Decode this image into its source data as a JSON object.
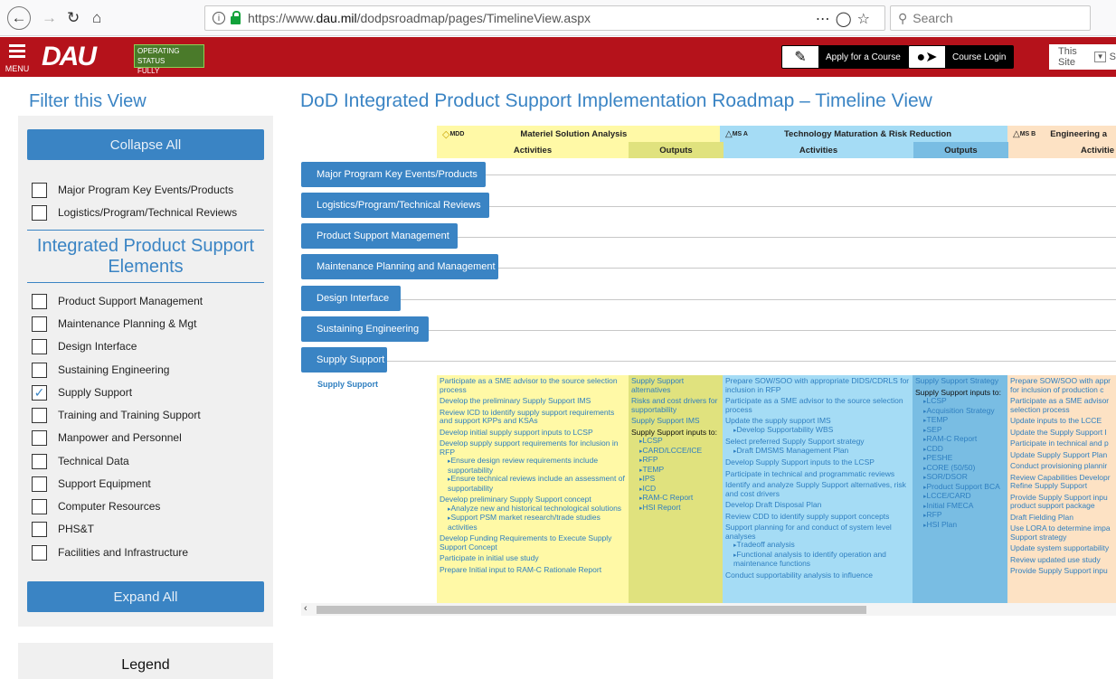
{
  "browser": {
    "url_prefix": "https://www.",
    "url_domain": "dau.mil",
    "url_path": "/dodpsroadmap/pages/TimelineView.aspx",
    "search_placeholder": "Search",
    "icons": [
      "back-arrow",
      "forward-arrow",
      "reload",
      "home",
      "more-dots",
      "pocket",
      "bookmark-star",
      "search-icon"
    ]
  },
  "header": {
    "menu_label": "MENU",
    "logo_text": "DAU",
    "status_line1": "OPERATING STATUS",
    "status_line2": "FULLY OPERATIONAL",
    "apply_label": "Apply for a Course",
    "login_label": "Course Login",
    "scope_label": "This Site",
    "scope_search": "S",
    "accent": "#b5121b"
  },
  "sidebar": {
    "filter_title": "Filter this View",
    "collapse_label": "Collapse All",
    "expand_label": "Expand All",
    "top_filters": [
      {
        "label": "Major Program Key Events/Products",
        "checked": false
      },
      {
        "label": "Logistics/Program/Technical Reviews",
        "checked": false
      }
    ],
    "ips_title": "Integrated Product Support Elements",
    "ips_filters": [
      {
        "label": "Product Support Management",
        "checked": false
      },
      {
        "label": "Maintenance Planning & Mgt",
        "checked": false
      },
      {
        "label": "Design Interface",
        "checked": false
      },
      {
        "label": "Sustaining Engineering",
        "checked": false
      },
      {
        "label": "Supply Support",
        "checked": true
      },
      {
        "label": "Training and Training Support",
        "checked": false
      },
      {
        "label": "Manpower and Personnel",
        "checked": false
      },
      {
        "label": "Technical Data",
        "checked": false
      },
      {
        "label": "Support Equipment",
        "checked": false
      },
      {
        "label": "Computer Resources",
        "checked": false
      },
      {
        "label": "PHS&T",
        "checked": false
      },
      {
        "label": "Facilities and Infrastructure",
        "checked": false
      }
    ],
    "legend_label": "Legend"
  },
  "main": {
    "title": "DoD Integrated Product Support Implementation Roadmap – Timeline View",
    "phases": [
      {
        "milestone": "MDD",
        "name": "Materiel Solution Analysis",
        "activities": "Activities",
        "outputs": "Outputs"
      },
      {
        "milestone": "MS A",
        "name": "Technology Maturation & Risk Reduction",
        "activities": "Activities",
        "outputs": "Outputs"
      },
      {
        "milestone": "MS B",
        "name": "Engineering a",
        "activities": "Activitie"
      }
    ],
    "rows": [
      "Major Program Key Events/Products",
      "Logistics/Program/Technical Reviews",
      "Product Support Management",
      "Maintenance Planning and Management",
      "Design Interface",
      "Sustaining Engineering",
      "Supply Support"
    ],
    "detail_label": "Supply Support",
    "col1": [
      "Participate as a SME advisor to the source selection process",
      "Develop the preliminary Supply Support IMS",
      "Review ICD to identify supply support requirements and support KPPs and KSAs",
      "Develop initial supply support inputs to LCSP",
      "Develop supply support requirements for inclusion in RFP"
    ],
    "col1_sub1": [
      "Ensure design review requirements include supportability",
      "Ensure technical reviews include an assessment of supportability"
    ],
    "col1_b": "Develop preliminary Supply Support concept",
    "col1_sub2": [
      "Analyze new and historical technological solutions",
      "Support PSM market research/trade studies activities"
    ],
    "col1_c": [
      "Develop Funding Requirements to Execute Supply Support Concept",
      "Participate in initial use study",
      "Prepare Initial input to RAM-C Rationale Report"
    ],
    "col2": [
      "Supply Support alternatives",
      "Risks and cost drivers for supportability",
      "Supply Support IMS"
    ],
    "col2_heading": "Supply Support inputs to:",
    "col2_list": [
      "LCSP",
      "CARD/LCCE/ICE",
      "RFP",
      "TEMP",
      "IPS",
      "ICD",
      "RAM-C Report",
      "HSI Report"
    ],
    "col3": [
      "Prepare SOW/SOO with appropriate DIDS/CDRLS for inclusion in RFP",
      "Participate as a SME advisor to the source selection process",
      "Update the supply support IMS"
    ],
    "col3_sub1": [
      "Develop Supportability WBS"
    ],
    "col3_b": "Select preferred Supply Support strategy",
    "col3_sub2": [
      "Draft DMSMS Management Plan"
    ],
    "col3_c": [
      "Develop Supply Support inputs to the LCSP",
      "Participate in technical and programmatic reviews",
      "Identify and analyze Supply Support alternatives, risk and cost drivers",
      "Develop Draft Disposal Plan",
      "Review CDD to identify supply support concepts",
      "Support planning for and conduct of system level analyses"
    ],
    "col3_sub3": [
      "Tradeoff analysis",
      "Functional analysis to identify operation and maintenance functions"
    ],
    "col3_d": "Conduct supportability analysis to influence",
    "col4_a": "Supply Support Strategy",
    "col4_heading": "Supply Support inputs to:",
    "col4_list": [
      "LCSP",
      "Acquisition Strategy",
      "TEMP",
      "SEP",
      "RAM-C Report",
      "CDD",
      "PESHE",
      "CORE (50/50)",
      "SOR/DSOR",
      "Product Support BCA",
      "LCCE/CARD",
      "Initial FMECA",
      "RFP",
      "HSI Plan"
    ],
    "col5": [
      "Prepare SOW/SOO with appr for inclusion of production c",
      "Participate as a SME advisor selection process",
      "Update inputs to the LCCE",
      "Update the Supply Support I",
      "Participate in technical and p",
      "Update Supply Support Plan",
      "Conduct provisioning plannir",
      "Review Capabilities Developr Refine Supply Support",
      "Provide Supply Support inpu product support package",
      "Draft Fielding Plan",
      "Use LORA to determine impa Support strategy",
      "Update system supportability",
      "Review updated use study",
      "Provide Supply Support inpu"
    ]
  }
}
